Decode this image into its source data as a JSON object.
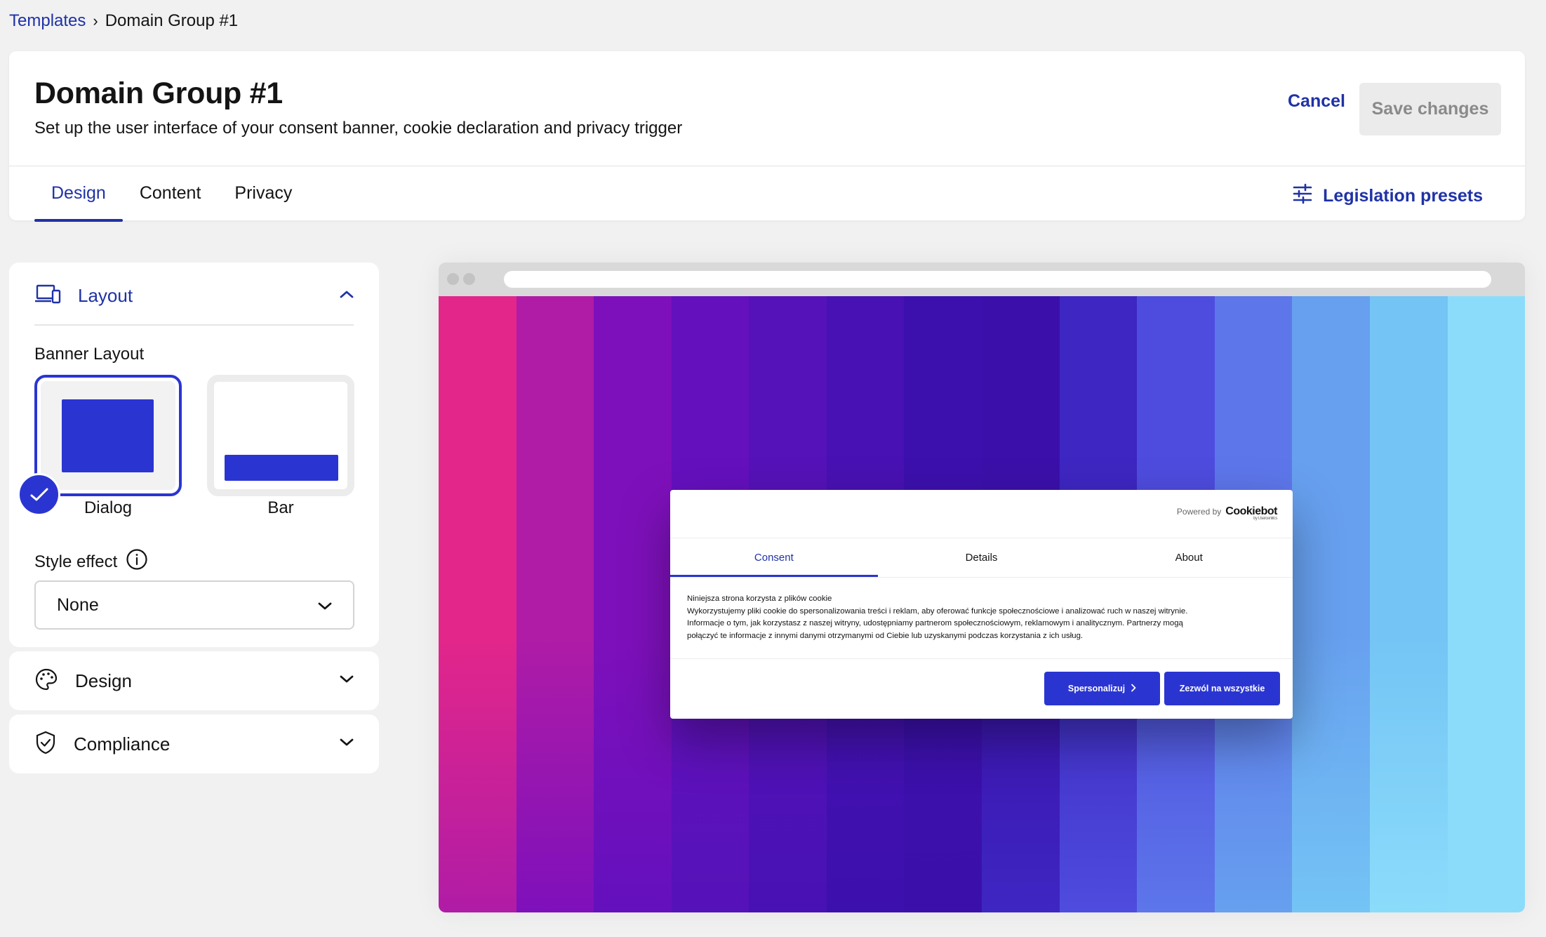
{
  "breadcrumb": {
    "parent": "Templates",
    "separator": "›",
    "current": "Domain Group #1"
  },
  "header": {
    "title": "Domain Group #1",
    "subtitle": "Set up the user interface of your consent banner, cookie declaration and privacy trigger",
    "cancel_label": "Cancel",
    "save_label": "Save changes",
    "tabs": [
      {
        "label": "Design",
        "active": true
      },
      {
        "label": "Content",
        "active": false
      },
      {
        "label": "Privacy",
        "active": false
      }
    ],
    "legislation_label": "Legislation presets"
  },
  "sidebar": {
    "layout": {
      "label": "Layout",
      "banner_layout_label": "Banner Layout",
      "options": [
        {
          "label": "Dialog",
          "selected": true
        },
        {
          "label": "Bar",
          "selected": false
        }
      ],
      "style_effect_label": "Style effect",
      "style_effect_value": "None"
    },
    "design_label": "Design",
    "compliance_label": "Compliance"
  },
  "preview": {
    "gradient_colors": [
      "#e3268a",
      "#b01ca6",
      "#7e10bb",
      "#6410bd",
      "#5512b8",
      "#4811b3",
      "#3c10ad",
      "#3b10aa",
      "#3e26c2",
      "#4e4cde",
      "#5d76ea",
      "#67a0ef",
      "#74c4f5",
      "#8bdcfb"
    ],
    "dialog": {
      "powered_by": "Powered by",
      "brand": "Cookiebot",
      "brand_sub": "by Usercentrics",
      "tabs": [
        {
          "label": "Consent",
          "active": true
        },
        {
          "label": "Details",
          "active": false
        },
        {
          "label": "About",
          "active": false
        }
      ],
      "body_title": "Niniejsza strona korzysta z plików cookie",
      "body_lines": [
        "Wykorzystujemy pliki cookie do spersonalizowania treści i reklam, aby oferować funkcje społecznościowe i analizować ruch w naszej witrynie.",
        "Informacje o tym, jak korzystasz z naszej witryny, udostępniamy partnerom społecznościowym, reklamowym i analitycznym. Partnerzy mogą",
        "połączyć te informacje z innymi danymi otrzymanymi od Ciebie lub uzyskanymi podczas korzystania z ich usług."
      ],
      "btn_customize": "Spersonalizuj",
      "btn_allow_all": "Zezwól na wszystkie"
    }
  },
  "colors": {
    "accent": "#1f32a6",
    "primary": "#2a35d1"
  }
}
